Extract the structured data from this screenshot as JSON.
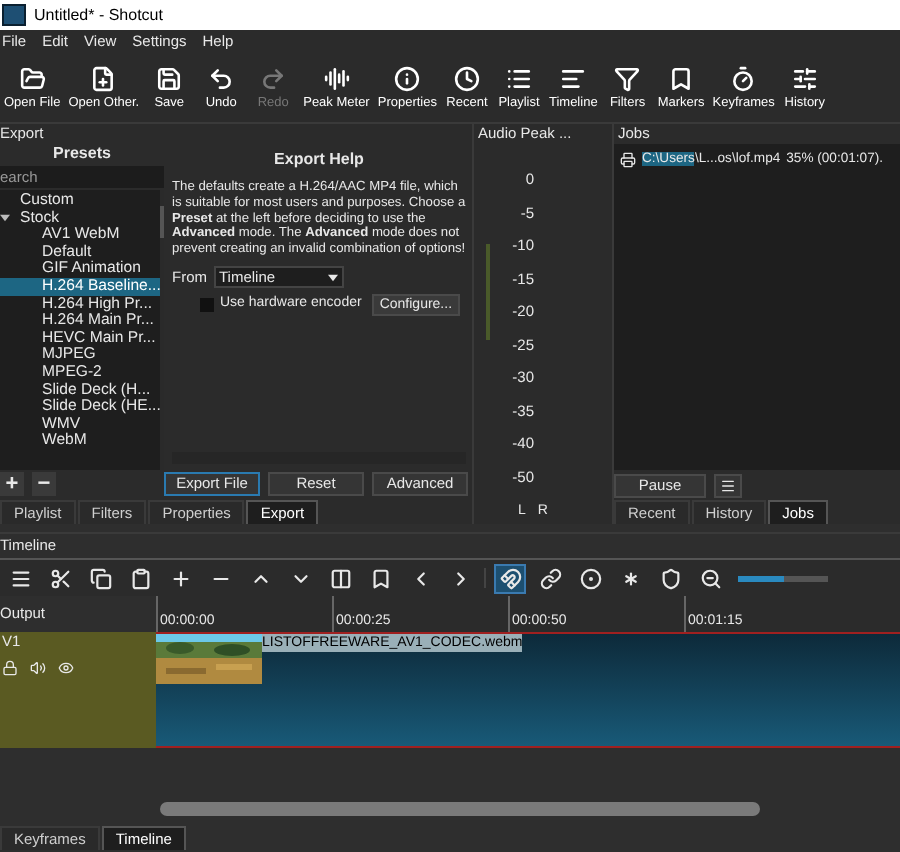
{
  "window": {
    "title": "Untitled* - Shotcut"
  },
  "menu": [
    "File",
    "Edit",
    "View",
    "Settings",
    "Help"
  ],
  "toolbar": [
    {
      "label": "Open File",
      "disabled": false
    },
    {
      "label": "Open Other.",
      "disabled": false
    },
    {
      "label": "Save",
      "disabled": false
    },
    {
      "label": "Undo",
      "disabled": false
    },
    {
      "label": "Redo",
      "disabled": true
    },
    {
      "label": "Peak Meter",
      "disabled": false
    },
    {
      "label": "Properties",
      "disabled": false
    },
    {
      "label": "Recent",
      "disabled": false
    },
    {
      "label": "Playlist",
      "disabled": false
    },
    {
      "label": "Timeline",
      "disabled": false
    },
    {
      "label": "Filters",
      "disabled": false
    },
    {
      "label": "Markers",
      "disabled": false
    },
    {
      "label": "Keyframes",
      "disabled": false
    },
    {
      "label": "History",
      "disabled": false
    }
  ],
  "export_panel": {
    "title": "Export",
    "presets_heading": "Presets",
    "search": {
      "placeholder": "earch"
    },
    "presets": [
      {
        "label": "Custom"
      },
      {
        "label": "Stock",
        "children": [
          {
            "label": "AV1 WebM",
            "selected": false
          },
          {
            "label": "Default",
            "selected": false
          },
          {
            "label": "GIF Animation",
            "selected": false
          },
          {
            "label": "H.264 Baseline...",
            "selected": true
          },
          {
            "label": "H.264 High Pr...",
            "selected": false
          },
          {
            "label": "H.264 Main Pr...",
            "selected": false
          },
          {
            "label": "HEVC Main Pr...",
            "selected": false
          },
          {
            "label": "MJPEG",
            "selected": false
          },
          {
            "label": "MPEG-2",
            "selected": false
          },
          {
            "label": "Slide Deck (H...",
            "selected": false
          },
          {
            "label": "Slide Deck (HE...",
            "selected": false
          },
          {
            "label": "WMV",
            "selected": false
          },
          {
            "label": "WebM",
            "selected": false
          }
        ]
      }
    ],
    "add_button": "+",
    "remove_button": "−",
    "help_title": "Export Help",
    "help_text": "The defaults create a H.264/AAC MP4 file, which is suitable for most users and purposes. Choose a **Preset** at the left before deciding to use the **Advanced** mode. The **Advanced** mode does not prevent creating an invalid combination of options!",
    "from_label": "From",
    "from_value": "Timeline",
    "hardware_encoder": {
      "label": "Use hardware encoder",
      "checked": false
    },
    "configure_button": "Configure...",
    "buttons": [
      "Export File",
      "Reset",
      "Advanced"
    ],
    "tabs": [
      {
        "label": "Playlist",
        "selected": false
      },
      {
        "label": "Filters",
        "selected": false
      },
      {
        "label": "Properties",
        "selected": false
      },
      {
        "label": "Export",
        "selected": true
      }
    ]
  },
  "audio_panel": {
    "title": "Audio Peak ...",
    "scale": [
      "0",
      "-5",
      "-10",
      "-15",
      "-20",
      "-25",
      "-30",
      "-35",
      "-40",
      "-50"
    ],
    "channels": [
      "L",
      "R"
    ]
  },
  "jobs_panel": {
    "title": "Jobs",
    "jobs": [
      {
        "path_selected": "C:\\Users",
        "path_rest": "\\L...os\\lof.mp4",
        "progress": "35% (00:01:07)."
      }
    ],
    "pause_button": "Pause",
    "tabs": [
      {
        "label": "Recent",
        "selected": false
      },
      {
        "label": "History",
        "selected": false
      },
      {
        "label": "Jobs",
        "selected": true
      }
    ]
  },
  "timeline": {
    "title": "Timeline",
    "tools": [
      {
        "on": false
      },
      {
        "on": false
      },
      {
        "on": false
      },
      {
        "on": false
      },
      {
        "on": false
      },
      {
        "on": false
      },
      {
        "on": false
      },
      {
        "on": false
      },
      {
        "on": false
      },
      {
        "on": false
      },
      {
        "on": false
      },
      {
        "on": false
      },
      {
        "on": true
      },
      {
        "on": false
      },
      {
        "on": false
      },
      {
        "on": false
      },
      {
        "on": false
      },
      {
        "on": false
      }
    ],
    "zoom": {
      "level": 0.5
    },
    "output_label": "Output",
    "ruler": [
      "00:00:00",
      "00:00:25",
      "00:00:50",
      "00:01:15"
    ],
    "tracks": [
      {
        "name": "V1",
        "clip": "LISTOFFREEWARE_AV1_CODEC.webm"
      }
    ],
    "tabs": [
      {
        "label": "Keyframes",
        "selected": false
      },
      {
        "label": "Timeline",
        "selected": true
      }
    ]
  }
}
